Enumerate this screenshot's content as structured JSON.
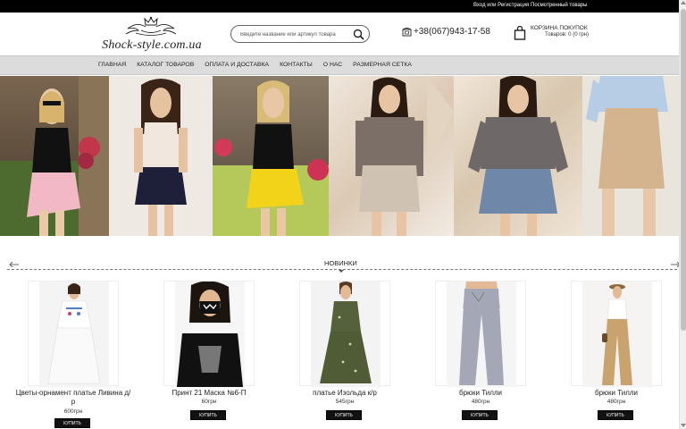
{
  "topbar": {
    "auth": "Вход или Регистрация",
    "favorites": "Посмотренный товары"
  },
  "header": {
    "logo_text": "Shock-style.com.ua",
    "search_placeholder": "Введите название или артикул товара",
    "phone": "+38(067)943-17-58",
    "cart_title": "КОРЗИНА ПОКУПОК",
    "cart_status": "Товаров: 0 (0 грн)"
  },
  "nav": {
    "items": [
      "ГЛАВНАЯ",
      "КАТАЛОГ ТОВАРОВ",
      "ОПЛАТА И ДОСТАВКА",
      "КОНТАКТЫ",
      "О НАС",
      "РАЗМЕРНАЯ СЕТКА"
    ]
  },
  "section": {
    "title": "НОВИНКИ"
  },
  "products": [
    {
      "name": "Цветы-орнамент платье Ливина д/р",
      "price": "600грн",
      "buy_label": "КУПИТЬ"
    },
    {
      "name": "Принт 21 Маска №6-П",
      "price": "60грн",
      "buy_label": "КУПИТЬ"
    },
    {
      "name": "платье Изольда к/р",
      "price": "545грн",
      "buy_label": "КУПИТЬ"
    },
    {
      "name": "брюки Тилли",
      "price": "480грн",
      "buy_label": "КУПИТЬ"
    },
    {
      "name": "брюки Тилли",
      "price": "480грн",
      "buy_label": "КУПИТЬ"
    }
  ]
}
